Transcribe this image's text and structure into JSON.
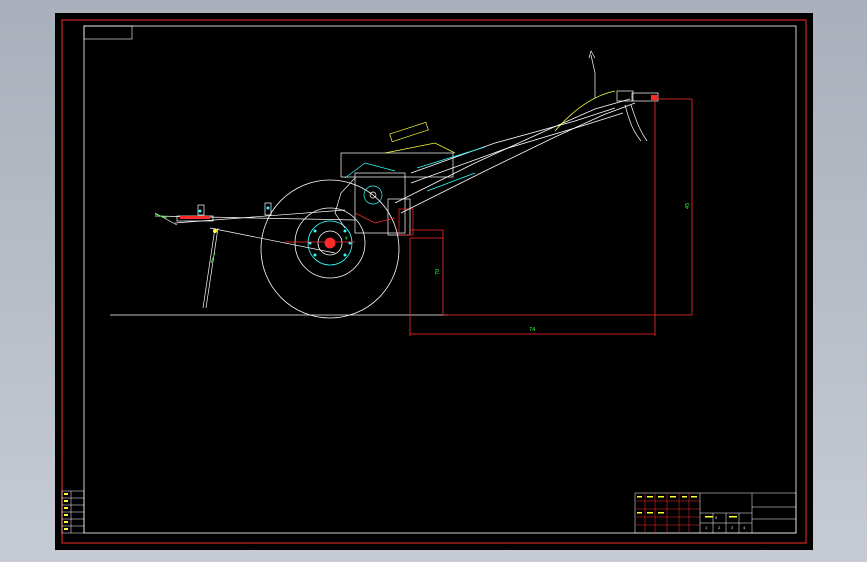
{
  "viewer": {
    "background_color": "#b4bac4",
    "sheet_color": "#000000"
  },
  "drawing": {
    "border_color": "#ff2a2a",
    "line_color": "#ffffff",
    "dim_color": "#ff2a2a",
    "dim_text_color": "#33ff33",
    "highlight_cyan": "#33ffff",
    "highlight_yellow": "#ffff33",
    "dimensions": {
      "vertical_left": "70",
      "horizontal": "74",
      "vertical_right": "45"
    }
  },
  "title_block": {
    "cells": [
      "1",
      "2",
      "3",
      "4",
      "5"
    ]
  }
}
